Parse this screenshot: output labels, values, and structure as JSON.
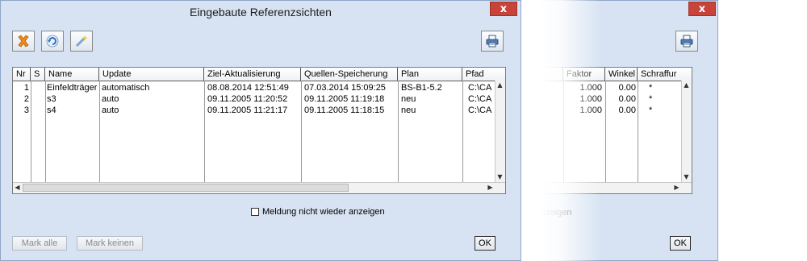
{
  "dialog": {
    "title": "Eingebaute Referenzsichten",
    "close_label": "x",
    "toolbar": {
      "delete_icon": "delete-x-icon",
      "refresh_icon": "refresh-icon",
      "wizard_icon": "magic-wand-icon",
      "print_icon": "printer-icon"
    },
    "table": {
      "columns": [
        "Nr",
        "S",
        "Name",
        "Update",
        "Ziel-Aktualisierung",
        "Quellen-Speicherung",
        "Plan",
        "Pfad"
      ],
      "rows": [
        {
          "nr": "1",
          "s": "",
          "name": "Einfeldträger",
          "update": "automatisch",
          "ziel": "08.08.2014 12:51:49",
          "quelle": "07.03.2014 15:09:25",
          "plan": "BS-B1-5.2",
          "pfad": "C:\\CA"
        },
        {
          "nr": "2",
          "s": "",
          "name": "s3",
          "update": "auto",
          "ziel": "09.11.2005 11:20:52",
          "quelle": "09.11.2005 11:19:18",
          "plan": "neu",
          "pfad": "C:\\CA"
        },
        {
          "nr": "3",
          "s": "",
          "name": "s4",
          "update": "auto",
          "ziel": "09.11.2005 11:21:17",
          "quelle": "09.11.2005 11:18:15",
          "plan": "neu",
          "pfad": "C:\\CA"
        }
      ]
    },
    "checkbox_label": "Meldung nicht wieder anzeigen",
    "checkbox_checked": false,
    "buttons": {
      "mark_all": "Mark alle",
      "mark_none": "Mark keinen",
      "ok": "OK"
    }
  },
  "second_window": {
    "close_label": "x",
    "print_icon": "printer-icon",
    "table": {
      "columns": [
        "Faktor",
        "Winkel",
        "Schraffur"
      ],
      "rows": [
        {
          "faktor": "1.000",
          "winkel": "0.00",
          "schraffur": "*"
        },
        {
          "faktor": "1.000",
          "winkel": "0.00",
          "schraffur": "*"
        },
        {
          "faktor": "1.000",
          "winkel": "0.00",
          "schraffur": "*"
        }
      ]
    },
    "label_fragment": "nzeigen",
    "ok_label": "OK"
  },
  "colors": {
    "window_bg": "#d7e3f3",
    "close_red": "#c7443a",
    "delete_orange": "#f08a1c",
    "refresh_blue": "#2c6fc0"
  }
}
